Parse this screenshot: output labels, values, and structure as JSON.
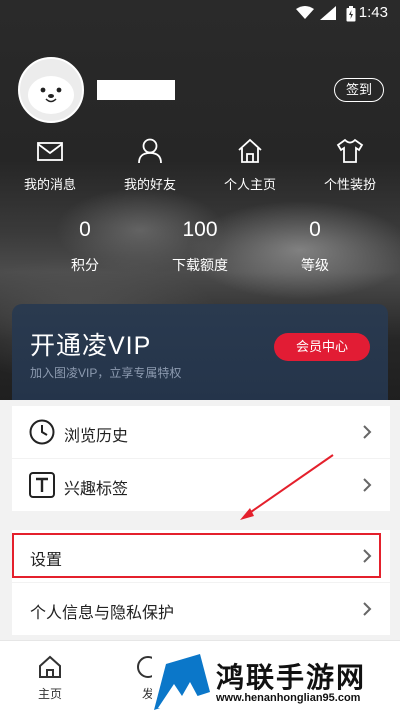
{
  "status_bar": {
    "time": "1:43"
  },
  "profile": {
    "signin_label": "签到"
  },
  "quick_links": [
    {
      "label": "我的消息",
      "icon": "mail-icon"
    },
    {
      "label": "我的好友",
      "icon": "person-icon"
    },
    {
      "label": "个人主页",
      "icon": "home-icon"
    },
    {
      "label": "个性装扮",
      "icon": "shirt-icon"
    }
  ],
  "stats": [
    {
      "value": "0",
      "label": "积分"
    },
    {
      "value": "100",
      "label": "下载额度"
    },
    {
      "value": "0",
      "label": "等级"
    }
  ],
  "vip": {
    "title": "开通凌VIP",
    "subtitle": "加入图凌VIP，立享专属特权",
    "button": "会员中心"
  },
  "menu": [
    {
      "label": "浏览历史",
      "icon": "clock-icon"
    },
    {
      "label": "兴趣标签",
      "icon": "tag-icon"
    },
    {
      "label": "设置"
    },
    {
      "label": "个人信息与隐私保护"
    }
  ],
  "bottom_nav": [
    {
      "label": "主页",
      "icon": "home-icon"
    },
    {
      "label": "发",
      "icon": "discover-icon"
    }
  ],
  "watermark": {
    "text": "鸿联手游网",
    "url": "www.henanhonglian95.com"
  },
  "colors": {
    "accent_red": "#e21c34",
    "vip_bg": "#24344a",
    "highlight": "#e4202c"
  }
}
